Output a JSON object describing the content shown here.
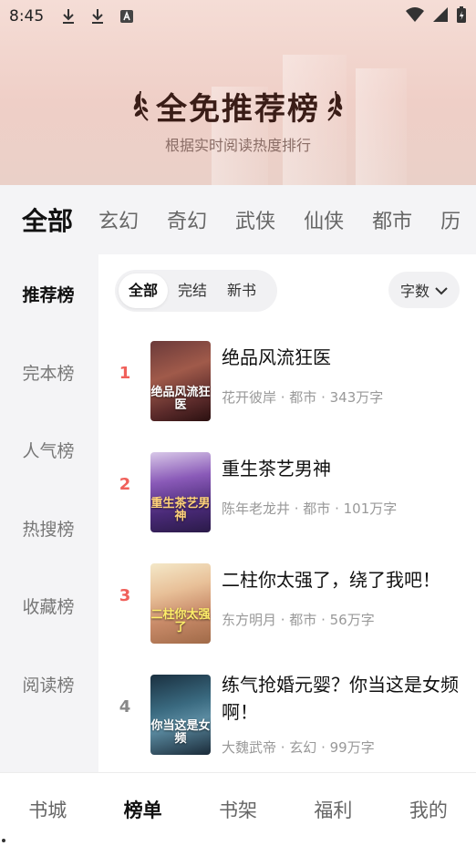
{
  "status_bar": {
    "time": "8:45",
    "left_icons": [
      "download-icon",
      "download-icon",
      "app-notification-icon"
    ],
    "right_icons": [
      "wifi-icon",
      "signal-icon",
      "battery-charging-icon"
    ]
  },
  "banner": {
    "title": "全免推荐榜",
    "subtitle": "根据实时阅读热度排行"
  },
  "category_tabs": [
    "全部",
    "玄幻",
    "奇幻",
    "武侠",
    "仙侠",
    "都市",
    "历"
  ],
  "side_nav": [
    "推荐榜",
    "完本榜",
    "人气榜",
    "热搜榜",
    "收藏榜",
    "阅读榜"
  ],
  "filters": {
    "options": [
      "全部",
      "完结",
      "新书"
    ],
    "sort_label": "字数"
  },
  "books": [
    {
      "rank": "1",
      "title": "绝品风流狂医",
      "meta": "花开彼岸 · 都市 · 343万字",
      "cover_text": "绝品风流狂医",
      "rank_color": "#f0605a"
    },
    {
      "rank": "2",
      "title": "重生茶艺男神",
      "meta": "陈年老龙井 · 都市 · 101万字",
      "cover_text": "重生茶艺男神",
      "rank_color": "#f0605a"
    },
    {
      "rank": "3",
      "title": "二柱你太强了，绕了我吧！",
      "meta": "东方明月 · 都市 · 56万字",
      "cover_text": "二柱你太强了",
      "rank_color": "#f0605a"
    },
    {
      "rank": "4",
      "title": "练气抢婚元婴？你当这是女频啊！",
      "meta": "大魏武帝 · 玄幻 · 99万字",
      "cover_text": "你当这是女频",
      "rank_color": "#888888"
    }
  ],
  "bottom_nav": [
    "书城",
    "榜单",
    "书架",
    "福利",
    "我的"
  ],
  "colors": {
    "accent_rank": "#f0605a",
    "banner_bg": "#efcfc7",
    "title_color": "#3a1d17"
  }
}
